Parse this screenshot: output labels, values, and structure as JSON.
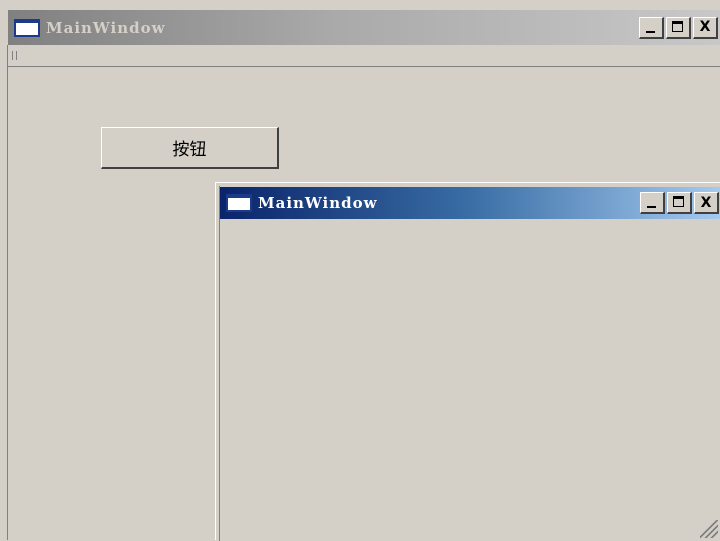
{
  "main_window": {
    "title": "MainWindow",
    "caption": {
      "minimize": "_",
      "maximize": "□",
      "close": "X"
    }
  },
  "content": {
    "button_label": "按钮"
  },
  "child_window": {
    "title": "MainWindow",
    "caption": {
      "minimize": "_",
      "maximize": "□",
      "close": "X"
    }
  },
  "colors": {
    "face": "#d4d0c8",
    "active_title_start": "#0a246a",
    "active_title_end": "#a6caf0",
    "inactive_title_start": "#808080"
  },
  "icons": [
    "window-icon",
    "minimize-icon",
    "maximize-icon",
    "close-icon",
    "menubar-grip-icon",
    "size-grip-icon"
  ]
}
